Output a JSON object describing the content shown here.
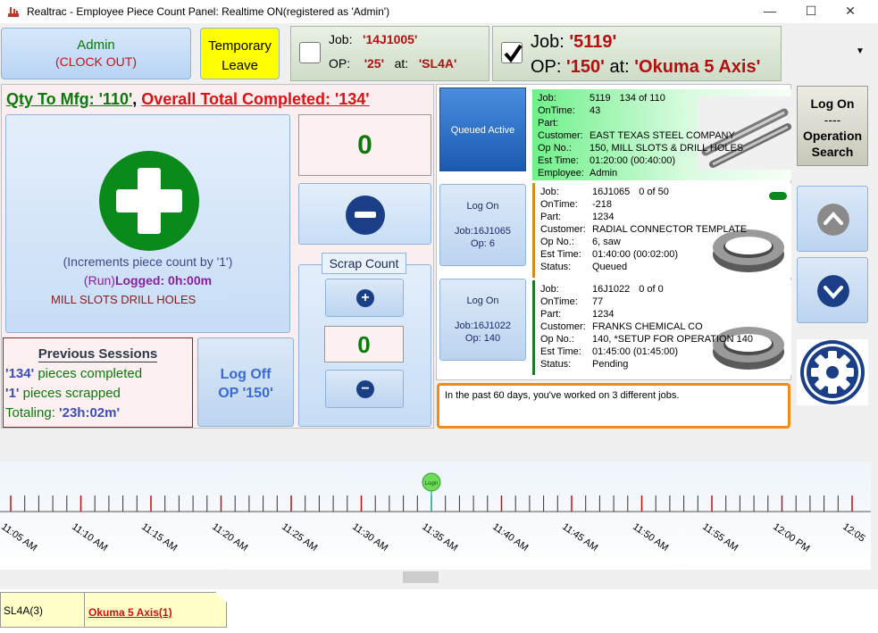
{
  "window": {
    "title": "Realtrac - Employee Piece Count Panel: Realtime ON(registered as 'Admin')",
    "minimize": "—",
    "maximize": "☐",
    "close": "✕"
  },
  "header": {
    "employee_name": "Admin",
    "clock_out": "(CLOCK OUT)",
    "temporary_leave_line1": "Temporary",
    "temporary_leave_line2": "Leave",
    "job_tab_1": {
      "job_label": "Job:",
      "job_value": "'14J1005'",
      "op_label": "OP:",
      "op_value": "'25'",
      "at_label": "at:",
      "at_value": "'SL4A'",
      "checked": false
    },
    "job_tab_2": {
      "job_label": "Job:",
      "job_value": "'5119'",
      "op_label": "OP:",
      "op_value": "'150'",
      "at_label": "at:",
      "at_value": "'Okuma 5 Axis'",
      "checked": true
    },
    "dropdown_glyph": "▼"
  },
  "summary": {
    "qty_label": "Qty To Mfg: '110'",
    "separator": ",",
    "overall_label": "Overall Total Completed: '134'"
  },
  "counter": {
    "increment_note": "(Increments piece count by '1')",
    "run_label": "(Run)",
    "logged": "Logged: 0h:00m",
    "op_description": "MILL SLOTS  DRILL HOLES",
    "piece_count": "0",
    "scrap_label": "Scrap Count",
    "scrap_count": "0",
    "scrap_plus": "+",
    "scrap_minus": "−"
  },
  "previous_sessions": {
    "title": "Previous Sessions",
    "completed_value": "'134'",
    "completed_text": " pieces completed",
    "scrapped_value": "'1'",
    "scrapped_text": " pieces scrapped",
    "totaling_text": "Totaling: ",
    "totaling_value": "'23h:02m'"
  },
  "logoff": {
    "line1": "Log Off",
    "line2": "OP  '150'"
  },
  "queue": {
    "queued_active": "Queued Active",
    "logon_buttons": [
      {
        "label": "Log On",
        "job": "Job:16J1065",
        "op": "Op: 6"
      },
      {
        "label": "Log On",
        "job": "Job:16J1022",
        "op": "Op: 140"
      }
    ],
    "cards": [
      {
        "rows": [
          {
            "label": "Job:",
            "value": "5119",
            "extra": "134 of 110"
          },
          {
            "label": "OnTime:",
            "value": "43"
          },
          {
            "label": "Part:",
            "value": ""
          },
          {
            "label": "Customer:",
            "value": "EAST TEXAS STEEL COMPANY"
          },
          {
            "label": "Op No.:",
            "value": "150, MILL SLOTS & DRILL HOLES"
          },
          {
            "label": "Est Time:",
            "value": "01:20:00 (00:40:00)"
          },
          {
            "label": "Employee:",
            "value": "Admin"
          }
        ]
      },
      {
        "rows": [
          {
            "label": "Job:",
            "value": "16J1065",
            "extra": "0 of 50"
          },
          {
            "label": "OnTime:",
            "value": "-218"
          },
          {
            "label": "Part:",
            "value": "1234"
          },
          {
            "label": "Customer:",
            "value": "RADIAL CONNECTOR TEMPLATE"
          },
          {
            "label": "Op No.:",
            "value": "6, saw"
          },
          {
            "label": "Est Time:",
            "value": "01:40:00 (00:02:00)"
          },
          {
            "label": "Status:",
            "value": "Queued"
          }
        ]
      },
      {
        "rows": [
          {
            "label": "Job:",
            "value": "16J1022",
            "extra": "0 of 0"
          },
          {
            "label": "OnTime:",
            "value": "77"
          },
          {
            "label": "Part:",
            "value": "1234"
          },
          {
            "label": "Customer:",
            "value": "FRANKS CHEMICAL CO"
          },
          {
            "label": "Op No.:",
            "value": "140, *SETUP FOR OPERATION 140"
          },
          {
            "label": "Est Time:",
            "value": "01:45:00 (01:45:00)"
          },
          {
            "label": "Status:",
            "value": "Pending"
          }
        ]
      }
    ],
    "message": "In the past 60 days, you've worked on 3 different jobs."
  },
  "right_panel": {
    "logon_line1": "Log On",
    "logon_line2": "----",
    "logon_line3": "Operation",
    "logon_line4": "Search"
  },
  "timeline": {
    "marker_label": "Login",
    "tick_labels": [
      "11:05 AM",
      "11:10 AM",
      "11:15 AM",
      "11:20 AM",
      "11:25 AM",
      "11:30 AM",
      "11:35 AM",
      "11:40 AM",
      "11:45 AM",
      "11:50 AM",
      "11:55 AM",
      "12:00 PM",
      "12:05"
    ],
    "marker_time": "11:35 AM"
  },
  "bottom_tabs": [
    {
      "label": "SL4A(3)"
    },
    {
      "label": "Okuma 5 Axis(1)"
    }
  ],
  "colors": {
    "green": "#0a7a0a",
    "red": "#b01010",
    "accent_blue": "#1a3f86",
    "orange_border": "#f28a14"
  }
}
